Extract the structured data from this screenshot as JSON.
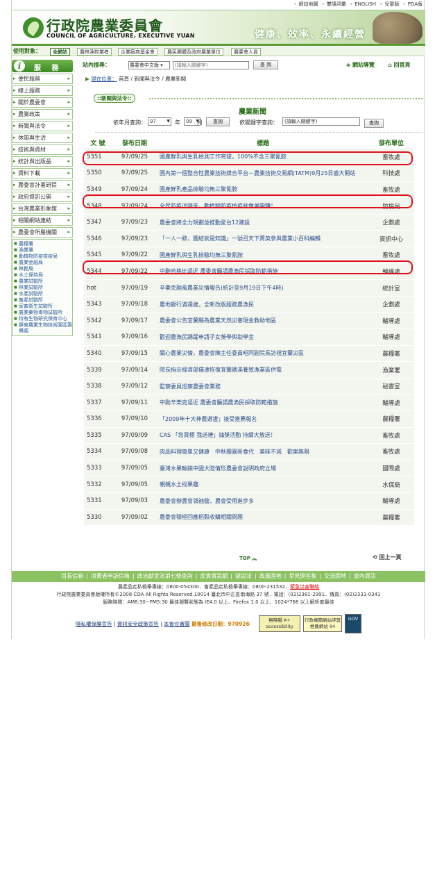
{
  "toplinks": [
    "網站地圖",
    "雙語詞彙",
    "ENGLISH",
    "兒童版",
    "PDA版"
  ],
  "header": {
    "title_cn": "行政院農業委員會",
    "title_en": "COUNCIL OF AGRICULTURE, EXECUTIVE YUAN",
    "slogan": "健康、效率、永續經營"
  },
  "audience": {
    "label": "使用對象：",
    "tabs": [
      "全網站",
      "農林漁牧業者",
      "企業廠商基金會",
      "農民團體及政府農業單位",
      "農委會人員"
    ]
  },
  "sidebar": {
    "title": "服 務",
    "items": [
      "便民服務",
      "線上服務",
      "關於農委會",
      "農業政策",
      "新聞與法令",
      "休閒與生活",
      "技術與資材",
      "統計與出版品",
      "資料下載",
      "農委會計畫研提",
      "政府資訊公開",
      "台灣農業形象館",
      "相關網站連結",
      "農委會所屬機關"
    ],
    "sub": [
      "農糧署",
      "漁業署",
      "動植物防疫檢疫局",
      "農業金融局",
      "林務局",
      "水土保持局",
      "農業試驗所",
      "林業試驗所",
      "水產試驗所",
      "畜產試驗所",
      "家畜衛生試驗所",
      "農業藥物毒物試驗所",
      "特有生物研究保育中心",
      "屏東農業生物技術園區籌備處"
    ]
  },
  "search": {
    "label": "站內搜尋：",
    "select": "農委會中文版",
    "placeholder": "(請輸入關鍵字)",
    "button": "查 詢"
  },
  "sitemap": "網站導覽",
  "home": "回首頁",
  "breadcrumb": {
    "head": "現在位置：",
    "path": "首頁 / 新聞與法令 / 農業新聞"
  },
  "section_tab": "::新聞與法令::",
  "news_title": "農業新聞",
  "filter": {
    "ym_label": "依年月查詢：",
    "year": "97",
    "year_unit": "年",
    "month": "09",
    "month_unit": "月",
    "btn1": "查詢",
    "kw_label": "依關鍵字查詢：",
    "kw_value": "(請輸入關鍵字)",
    "btn2": "查詢"
  },
  "table": {
    "headers": [
      "文 號",
      "發布日期",
      "標題",
      "發布單位"
    ],
    "rows": [
      [
        "5351",
        "97/09/25",
        "國產鮮乳與生乳檢測工作完竣，100%不含三聚氰胺",
        "畜牧處"
      ],
      [
        "5350",
        "97/09/25",
        "國內第一個整合性農業技術媒合平台－農業技術交易網(TATM)9月25日盛大開站",
        "科技處"
      ],
      [
        "5349",
        "97/09/24",
        "國產鮮乳產品檢驗均無三聚氰胺",
        "畜牧處"
      ],
      [
        "5348",
        "97/09/24",
        "全民防疫逗陣來，動植物防疫檢疫映像展開鑼！",
        "防檢局"
      ],
      [
        "5347",
        "97/09/23",
        "農委會將全力規劃並推動愛台12建設",
        "企劃處"
      ],
      [
        "5346",
        "97/09/23",
        "「一人一辭，團結就是知識」一號召天下菁英參與農業小百科編輯",
        "資訊中心"
      ],
      [
        "5345",
        "97/09/22",
        "國產鮮乳與生乳檢驗均無三聚氰胺",
        "畜牧處"
      ],
      [
        "5344",
        "97/09/22",
        "中颱哈格比逼近 農委會籲請農漁民採取防範措施",
        "輔導處"
      ],
      [
        "hot",
        "97/09/19",
        "辛樂克颱風農業災情報告(統計至9月19日下午4時)",
        "統計室"
      ],
      [
        "5343",
        "97/09/18",
        "農地銀行滿週歲，全新改版服務農漁民",
        "企劃處"
      ],
      [
        "5342",
        "97/09/17",
        "農委會公告宜蘭縣為農業天然災害現金救助地區",
        "輔導處"
      ],
      [
        "5341",
        "97/09/16",
        "歡迎農漁民踴躍申請子女獎學與助學金",
        "輔導處"
      ],
      [
        "5340",
        "97/09/15",
        "關心農業災情，農委會陳主任委員昭同副院長訪視宜蘭災區",
        "農糧署"
      ],
      [
        "5339",
        "97/09/14",
        "院長指示經濟部儘速恢復宜蘭礁溪養殖漁業區供電",
        "漁業署"
      ],
      [
        "5338",
        "97/09/12",
        "監察委員巡察農委會業務",
        "秘書室"
      ],
      [
        "5337",
        "97/09/11",
        "中颱辛樂克逼近 農委會籲請農漁民採取防範措施",
        "輔導處"
      ],
      [
        "5336",
        "97/09/10",
        "「2009年十大神農選拔」接受推薦報名",
        "農糧署"
      ],
      [
        "5335",
        "97/09/09",
        "CAS 「您買標 我送禮」抽獎活動 持續大放送！",
        "畜牧處"
      ],
      [
        "5334",
        "97/09/08",
        "肉品料理簡單又健康　中秋團圓新食代　美味不減　歡樂無限",
        "畜牧處"
      ],
      [
        "5333",
        "97/09/05",
        "臺灣水果輸銷中國大陸情形農委會說明政府立場",
        "國際處"
      ],
      [
        "5332",
        "97/09/05",
        "親親水土找果趣",
        "水保局"
      ],
      [
        "5331",
        "97/09/03",
        "農委會辦農會領袖營，農會受用進步多",
        "輔導處"
      ],
      [
        "5330",
        "97/09/02",
        "農委會積極回應稻穀收購相關問題",
        "農糧署"
      ]
    ]
  },
  "top_link": "TOP ︽",
  "back_link": "回上一頁",
  "footer_nav": [
    "首長信箱",
    "消費者申訴信箱",
    "政治獻金法第七條查詢",
    "反貪資訊網",
    "避說法",
    "政風園地",
    "常見問答集",
    "交流園地",
    "會內資訊"
  ],
  "footer": {
    "line1": "農產品走私檢舉專線：0800-054300．畜產品走私檢舉專線：0800-231532．",
    "line1_red": "緊急災害聯絡",
    "line2": "行政院農業委員會版權所有©2008 COA All Rights Reserved.10014 臺北市中正區南海路 37 號．電話：(02)2381-2991．傳真：(02)2331-0341",
    "line3": "服務時間：AM8:30~PM5:30 最佳瀏覽狀態為 IE4.0 以上、Firefox 1.0 以上、1024*768 以上解析度最佳",
    "links": [
      "隱私權保護宣告",
      "資訊安全政策宣告",
      "本會位置圖"
    ],
    "update": "最後修改日期：970926",
    "badge1": "無障礙 A+ accessibility",
    "badge2": "行政機關網站評獎 推薦網站 94",
    "badge3": "GOV"
  },
  "colors": {
    "green": "#3b8a24",
    "ring": "#e00f1a",
    "link": "#2a4a8a"
  }
}
